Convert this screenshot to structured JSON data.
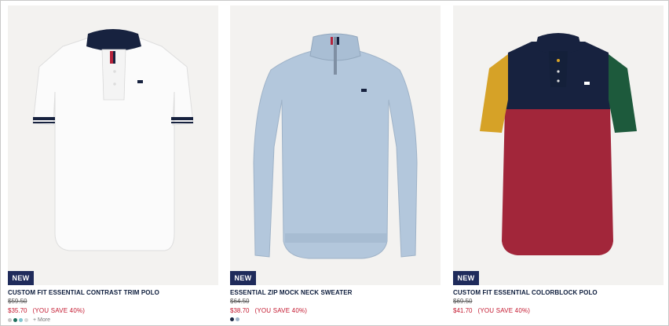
{
  "products": [
    {
      "badge": "NEW",
      "name": "CUSTOM FIT ESSENTIAL CONTRAST TRIM POLO",
      "original_price": "$59.50",
      "sale_price": "$35.70",
      "savings": "(YOU SAVE 40%)",
      "swatch_colors": [
        "#c8c8c8",
        "#1e6f5c",
        "#7fc6d0",
        "#d9d9d9"
      ],
      "more_label": "+ More",
      "image_icon": "white-polo-shirt-image"
    },
    {
      "badge": "NEW",
      "name": "ESSENTIAL ZIP MOCK NECK SWEATER",
      "original_price": "$64.50",
      "sale_price": "$38.70",
      "savings": "(YOU SAVE 40%)",
      "swatch_colors": [
        "#1b2744",
        "#9fb4c9"
      ],
      "image_icon": "blue-quarter-zip-sweater-image"
    },
    {
      "badge": "NEW",
      "name": "CUSTOM FIT ESSENTIAL COLORBLOCK POLO",
      "original_price": "$69.50",
      "sale_price": "$41.70",
      "savings": "(YOU SAVE 40%)",
      "image_icon": "colorblock-polo-shirt-image"
    }
  ],
  "colors": {
    "badge_bg": "#1f2b5b",
    "sale": "#c3172e",
    "tile_bg": "#f3f2f0"
  }
}
